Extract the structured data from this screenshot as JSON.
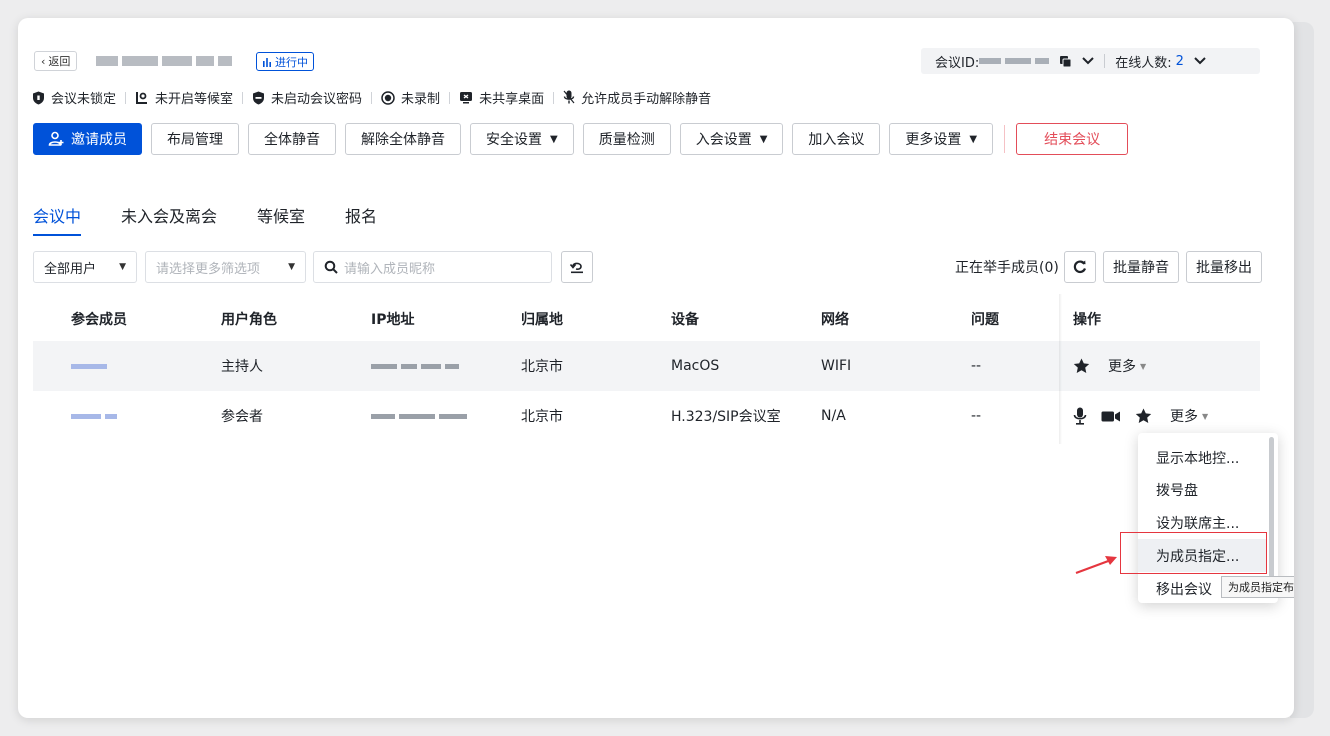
{
  "header": {
    "back_label": "返回",
    "status_badge": "进行中",
    "meeting_id_label": "会议ID:",
    "online_label": "在线人数:",
    "online_count": "2"
  },
  "status_bar": [
    {
      "icon": "shield-icon",
      "label": "会议未锁定"
    },
    {
      "icon": "waiting-room-icon",
      "label": "未开启等候室"
    },
    {
      "icon": "lock-icon",
      "label": "未启动会议密码"
    },
    {
      "icon": "record-icon",
      "label": "未录制"
    },
    {
      "icon": "screen-share-icon",
      "label": "未共享桌面"
    },
    {
      "icon": "mic-icon",
      "label": "允许成员手动解除静音"
    }
  ],
  "toolbar": {
    "invite": "邀请成员",
    "layout": "布局管理",
    "mute_all": "全体静音",
    "unmute_all": "解除全体静音",
    "security": "安全设置",
    "quality": "质量检测",
    "join_settings": "入会设置",
    "join_meeting": "加入会议",
    "more_settings": "更多设置",
    "end_meeting": "结束会议"
  },
  "tabs": [
    "会议中",
    "未入会及离会",
    "等候室",
    "报名"
  ],
  "filters": {
    "user_select": "全部用户",
    "more_filter_placeholder": "请选择更多筛选项",
    "search_placeholder": "请输入成员昵称",
    "hand_raise": "正在举手成员(0)",
    "batch_mute": "批量静音",
    "batch_remove": "批量移出"
  },
  "table": {
    "headers": [
      "参会成员",
      "用户角色",
      "IP地址",
      "归属地",
      "设备",
      "网络",
      "问题",
      "操作"
    ],
    "rows": [
      {
        "role": "主持人",
        "location": "北京市",
        "device": "MacOS",
        "network": "WIFI",
        "issue": "--",
        "more": "更多"
      },
      {
        "role": "参会者",
        "location": "北京市",
        "device": "H.323/SIP会议室",
        "network": "N/A",
        "issue": "--",
        "more": "更多"
      }
    ]
  },
  "menu": {
    "items": [
      "显示本地控...",
      "拨号盘",
      "设为联席主...",
      "为成员指定...",
      "移出会议"
    ],
    "tooltip": "为成员指定布局"
  },
  "colors": {
    "primary": "#0052d9",
    "danger": "#e34d59",
    "annotation": "#e5363f"
  }
}
